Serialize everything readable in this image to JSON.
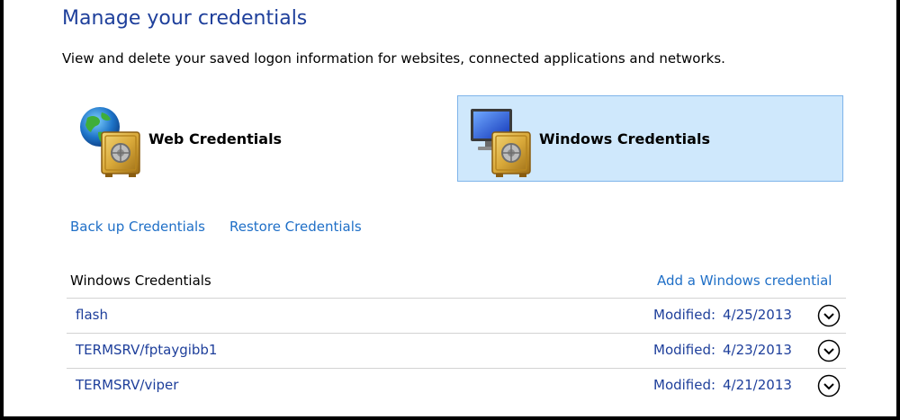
{
  "header": {
    "title": "Manage your credentials",
    "subtitle": "View and delete your saved logon information for websites, connected applications and networks."
  },
  "credential_types": [
    {
      "label": "Web Credentials",
      "icon": "globe-vault-icon",
      "selected": false
    },
    {
      "label": "Windows Credentials",
      "icon": "monitor-vault-icon",
      "selected": true
    }
  ],
  "actions": {
    "backup": "Back up Credentials",
    "restore": "Restore Credentials"
  },
  "section": {
    "title": "Windows Credentials",
    "add_link": "Add a Windows credential",
    "modified_label": "Modified:",
    "rows": [
      {
        "name": "flash",
        "date": "4/25/2013"
      },
      {
        "name": "TERMSRV/fptaygibb1",
        "date": "4/23/2013"
      },
      {
        "name": "TERMSRV/viper",
        "date": "4/21/2013"
      }
    ]
  },
  "colors": {
    "heading_blue": "#1e3f9b",
    "link_blue": "#1f6fc7",
    "selected_bg": "#cfe8fc",
    "selected_border": "#7eb4ea"
  }
}
